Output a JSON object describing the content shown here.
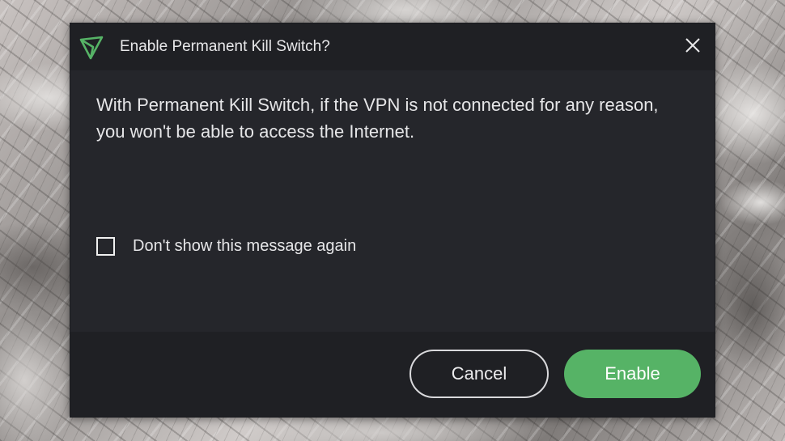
{
  "dialog": {
    "title": "Enable Permanent Kill Switch?",
    "logo_icon": "protonvpn-triangle-logo",
    "close_icon": "close-icon",
    "message": "With Permanent Kill Switch, if the VPN is not connected for any reason, you won't be able to access the Internet.",
    "checkbox": {
      "label": "Don't show this message again",
      "checked": false
    },
    "buttons": {
      "cancel_label": "Cancel",
      "enable_label": "Enable"
    }
  },
  "colors": {
    "dialog_background": "#25262b",
    "titlebar_background": "#1f2024",
    "accent_green": "#56b366",
    "text": "#e6e6e8"
  }
}
